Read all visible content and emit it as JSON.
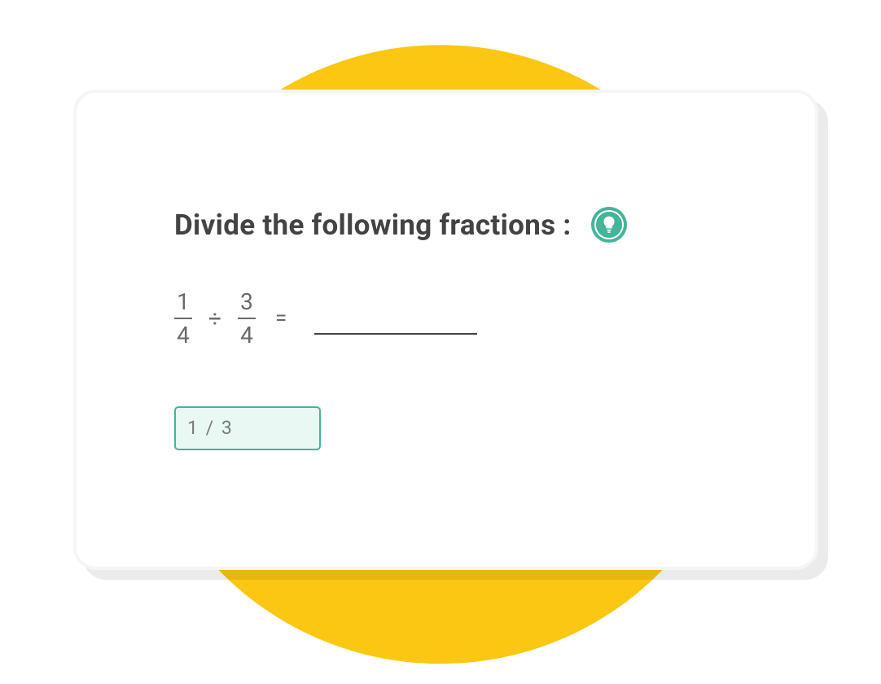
{
  "question": {
    "prompt": "Divide the following fractions :"
  },
  "equation": {
    "fraction1": {
      "numerator": "1",
      "denominator": "4"
    },
    "operator": "÷",
    "fraction2": {
      "numerator": "3",
      "denominator": "4"
    },
    "equals": "="
  },
  "answer": {
    "value": "1 / 3"
  },
  "colors": {
    "accent_circle": "#fbc712",
    "hint_badge": "#42b59b",
    "card_border": "#f5f5f5",
    "text_dark": "#434343",
    "text_muted": "#6a6a6a"
  }
}
